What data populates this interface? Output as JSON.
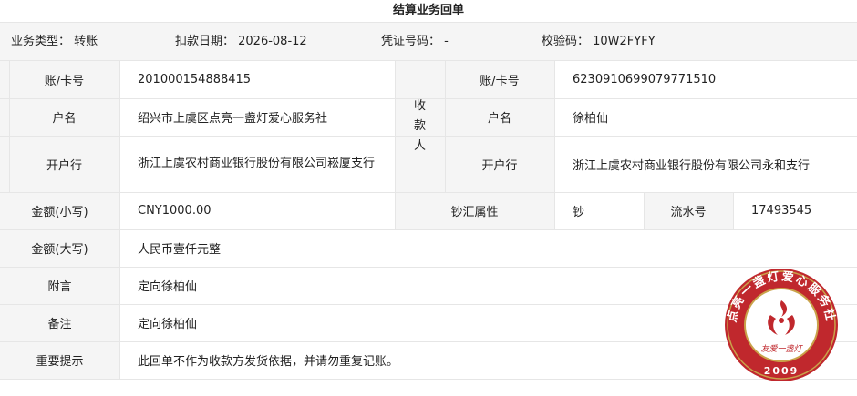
{
  "title": "结算业务回单",
  "meta": {
    "business_type": "业务类型：  转账",
    "debit_date": "扣款日期：  2026-08-12",
    "voucher_no": "凭证号码：  -",
    "check_code": "校验码：  10W2FYFY"
  },
  "payer": {
    "account_label": "账/卡号",
    "account": "201000154888415",
    "name_label": "户名",
    "name": "绍兴市上虞区点亮一盏灯爱心服务社",
    "bank_label": "开户行",
    "bank": "浙江上虞农村商业银行股份有限公司崧厦支行"
  },
  "payee": {
    "side_label": "收款人",
    "account_label": "账/卡号",
    "account": "6230910699079771510",
    "name_label": "户名",
    "name": "徐柏仙",
    "bank_label": "开户行",
    "bank": "浙江上虞农村商业银行股份有限公司永和支行"
  },
  "amount_small_label": "金额(小写)",
  "amount_small": "CNY1000.00",
  "cash_attr_label": "钞汇属性",
  "cash_attr": "钞",
  "serial_label": "流水号",
  "serial": "17493545",
  "amount_big_label": "金额(大写)",
  "amount_big": "人民币壹仟元整",
  "postscript_label": "附言",
  "postscript": "定向徐柏仙",
  "remark_label": "备注",
  "remark": "定向徐柏仙",
  "notice_label": "重要提示",
  "notice": "此回单不作为收款方发货依据，并请勿重复记账。",
  "stamp": {
    "ring_text": "点亮一盏灯爱心服务社",
    "center_text": "友爱一盏灯",
    "year": "2009",
    "color": "#c0282d",
    "gold": "#c9a24a"
  }
}
